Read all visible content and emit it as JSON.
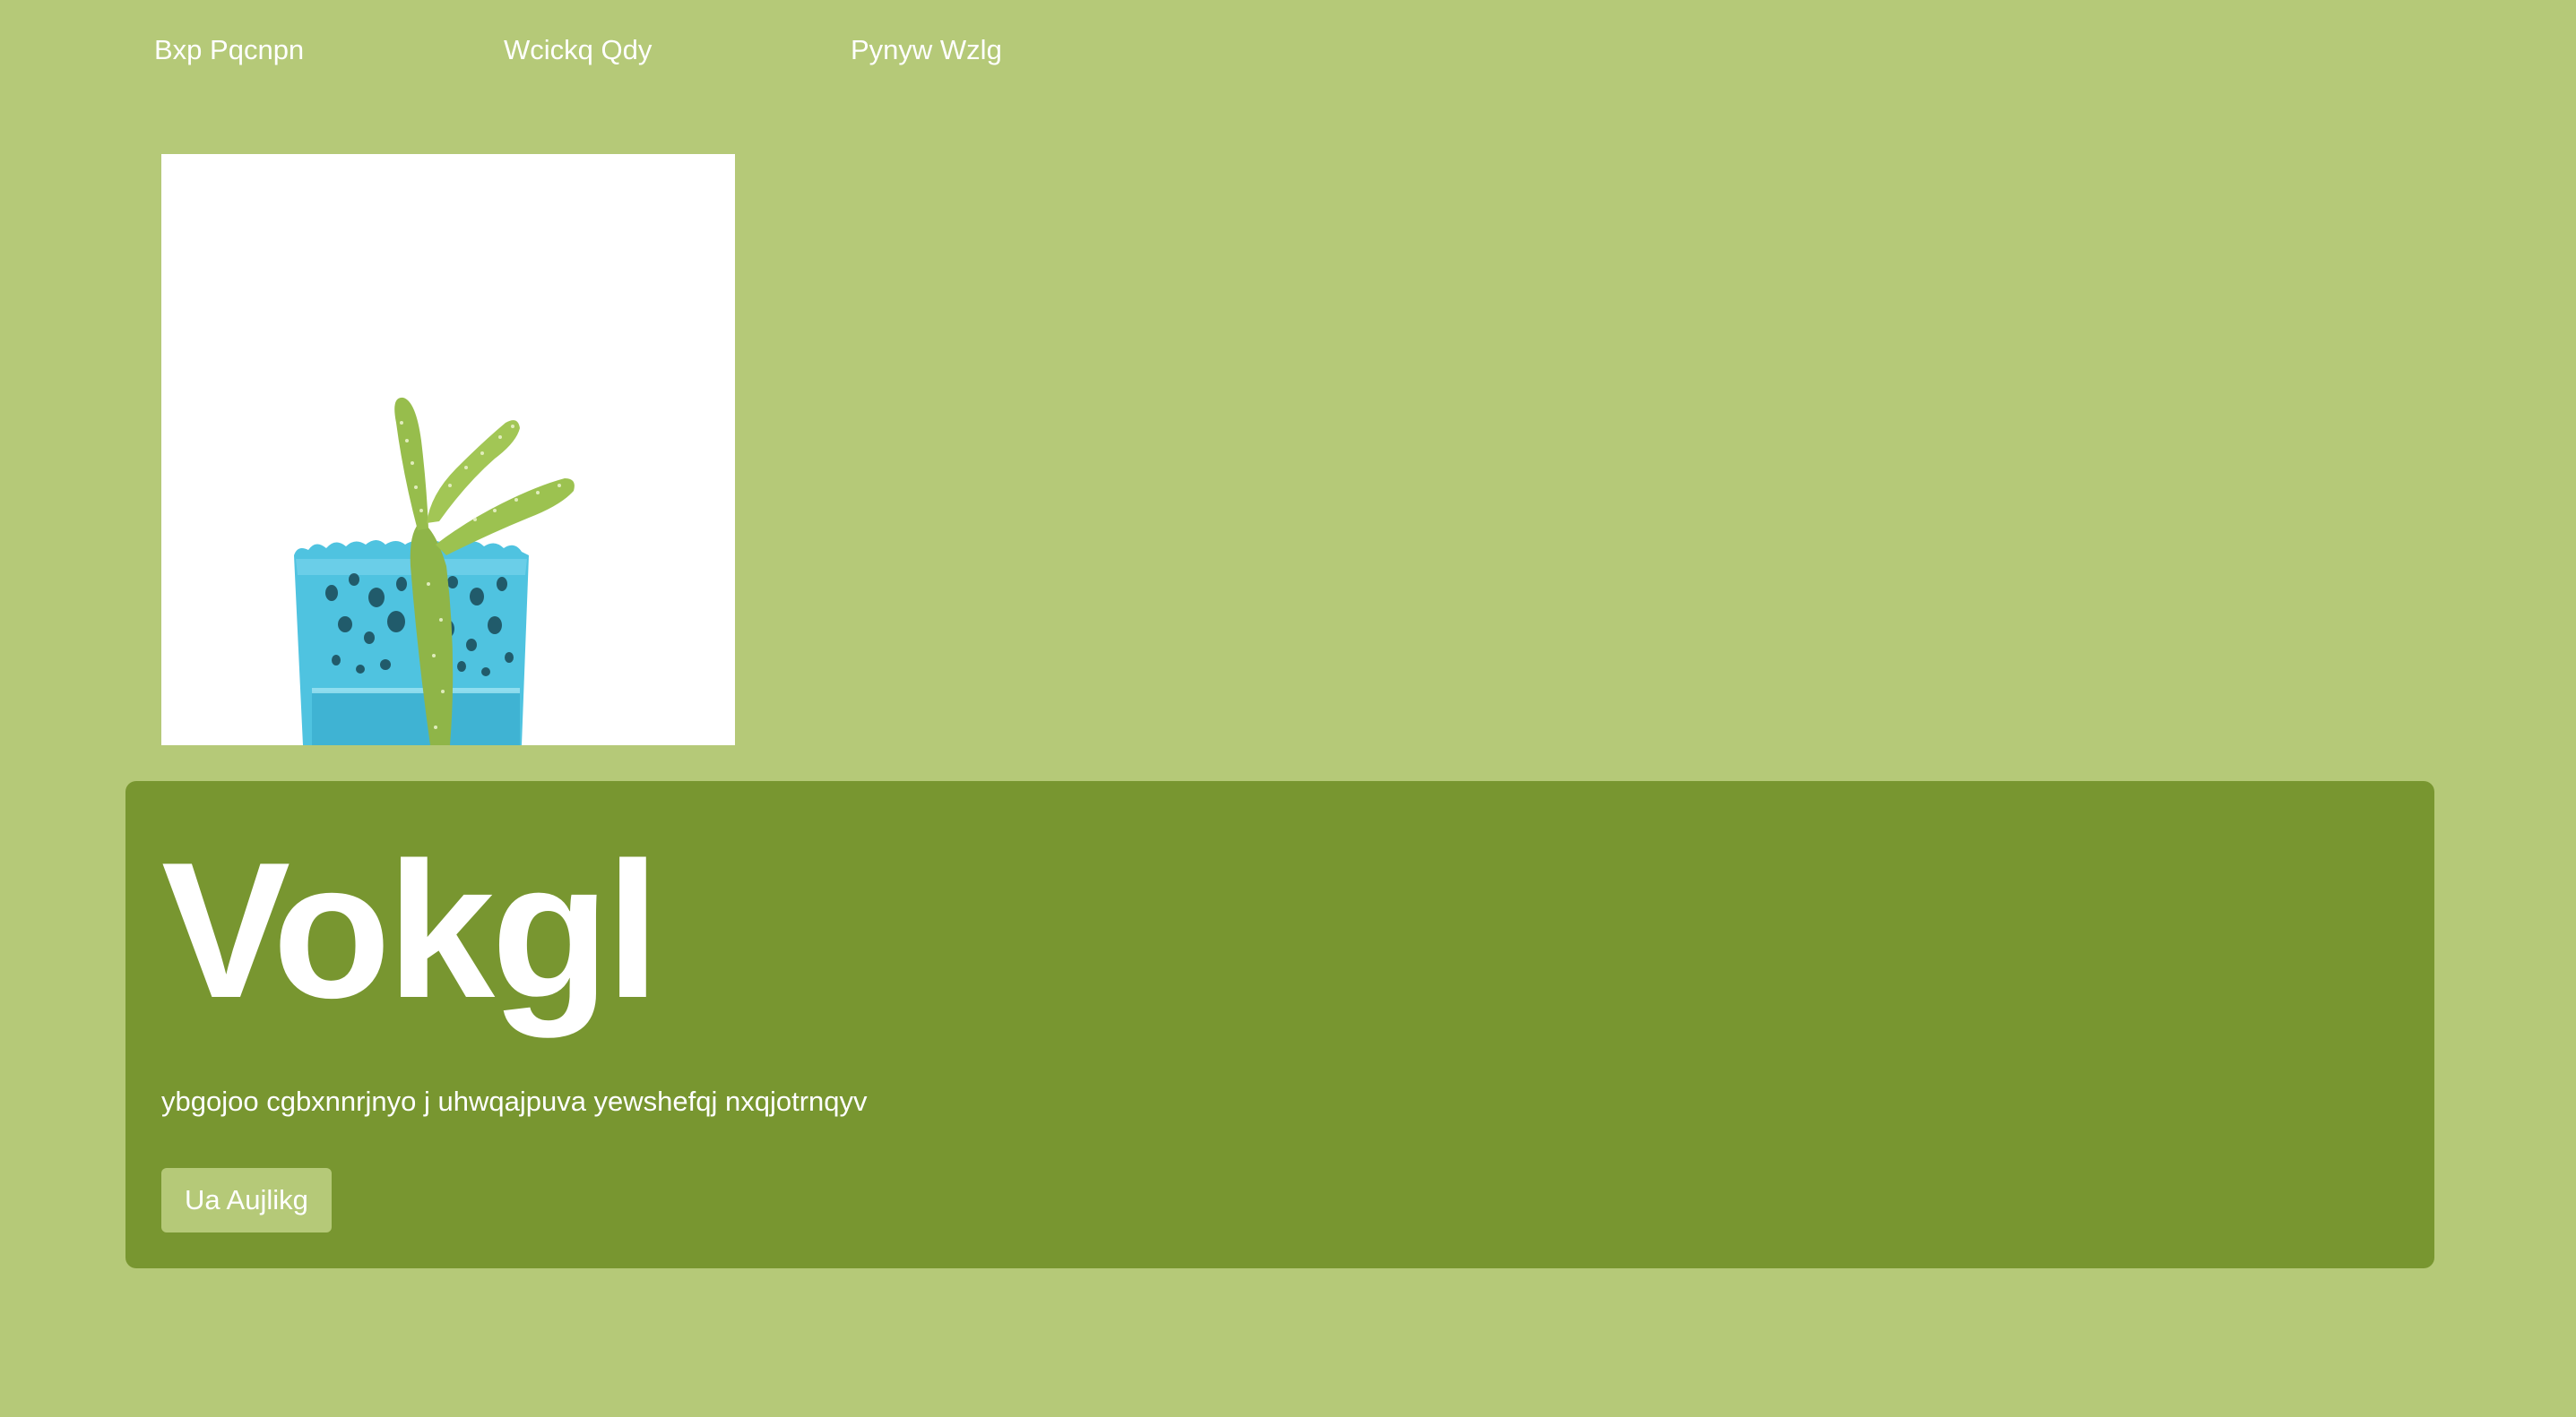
{
  "nav": {
    "links": [
      {
        "label": "Bxp Pqcnpn"
      },
      {
        "label": "Wcickq Qdy"
      },
      {
        "label": "Pynyw Wzlg"
      }
    ]
  },
  "hero": {
    "image": {
      "icon": "cactus-in-blue-lace-pot-photo"
    },
    "title": "Vokgl",
    "description": "ybgojoo cgbxnnrjnyo j uhwqajpuva yewshefqj nxqjotrnqyv",
    "button_label": "Ua Aujlikg"
  },
  "colors": {
    "page_background": "#b5c978",
    "card_background": "#789630",
    "button_background": "#b5c978",
    "text": "#ffffff",
    "pot_blue": "#4fc3e0",
    "cactus_green": "#8fb548"
  }
}
